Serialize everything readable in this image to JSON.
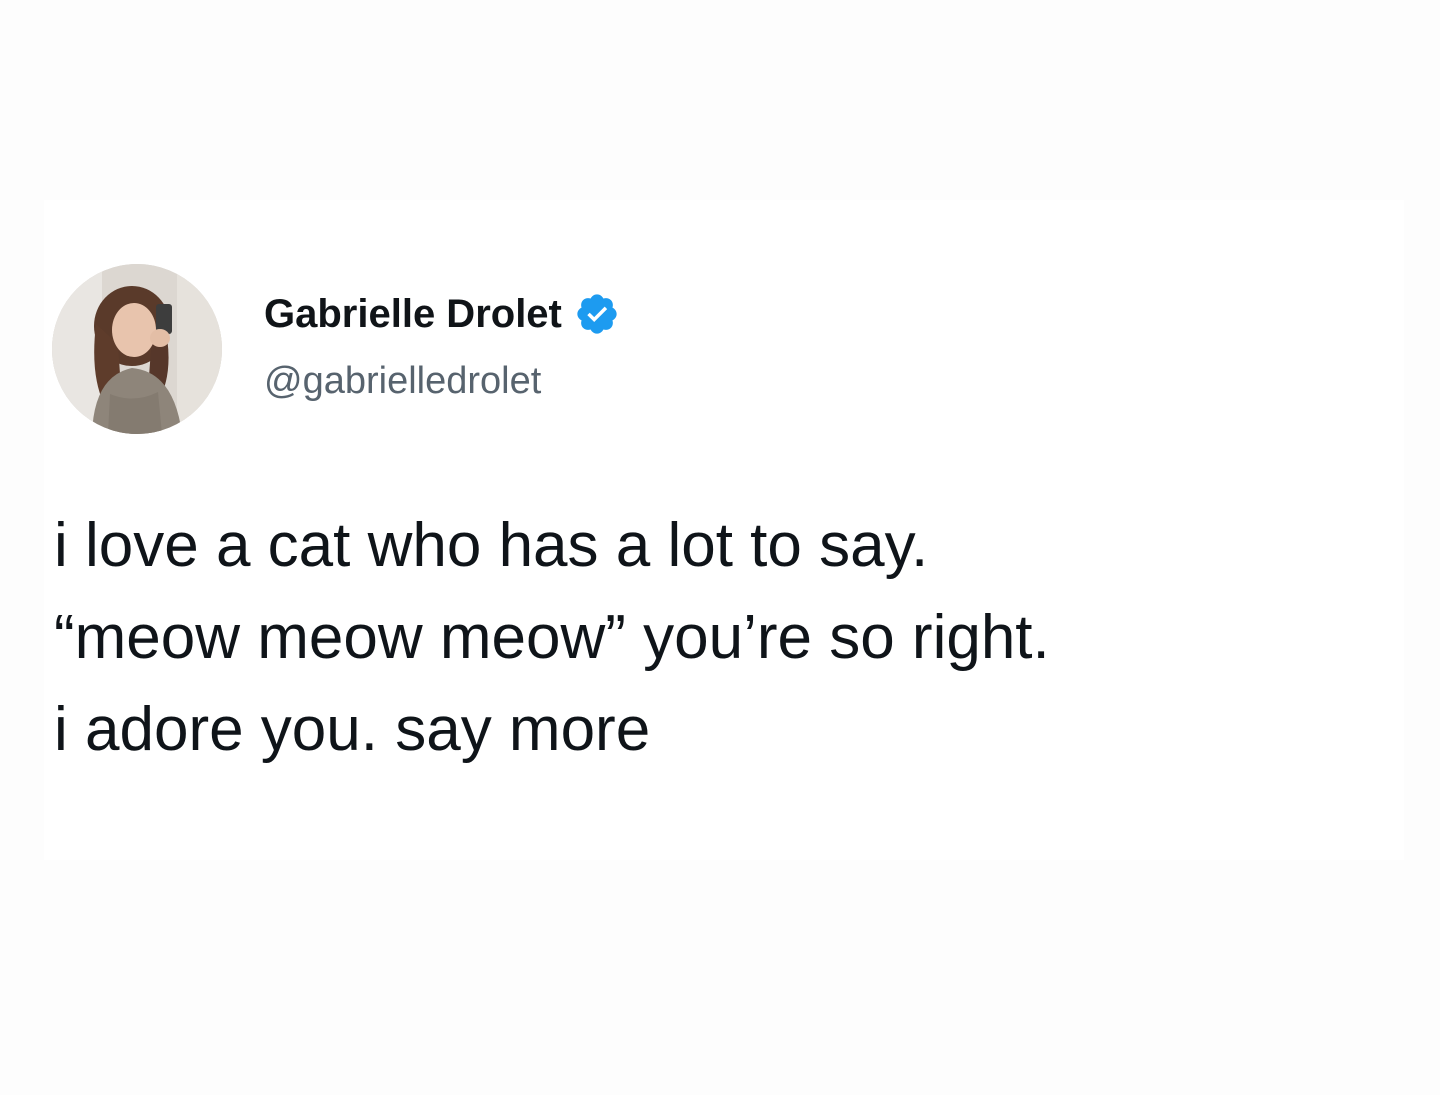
{
  "tweet": {
    "author": {
      "display_name": "Gabrielle Drolet",
      "handle": "@gabrielledrolet",
      "verified_icon": "verified-badge-icon",
      "verified_color": "#1d9bf0"
    },
    "text_lines": [
      "i love a cat who has a lot to say.",
      "“meow meow meow” you’re so right.",
      "i adore you. say more"
    ]
  }
}
